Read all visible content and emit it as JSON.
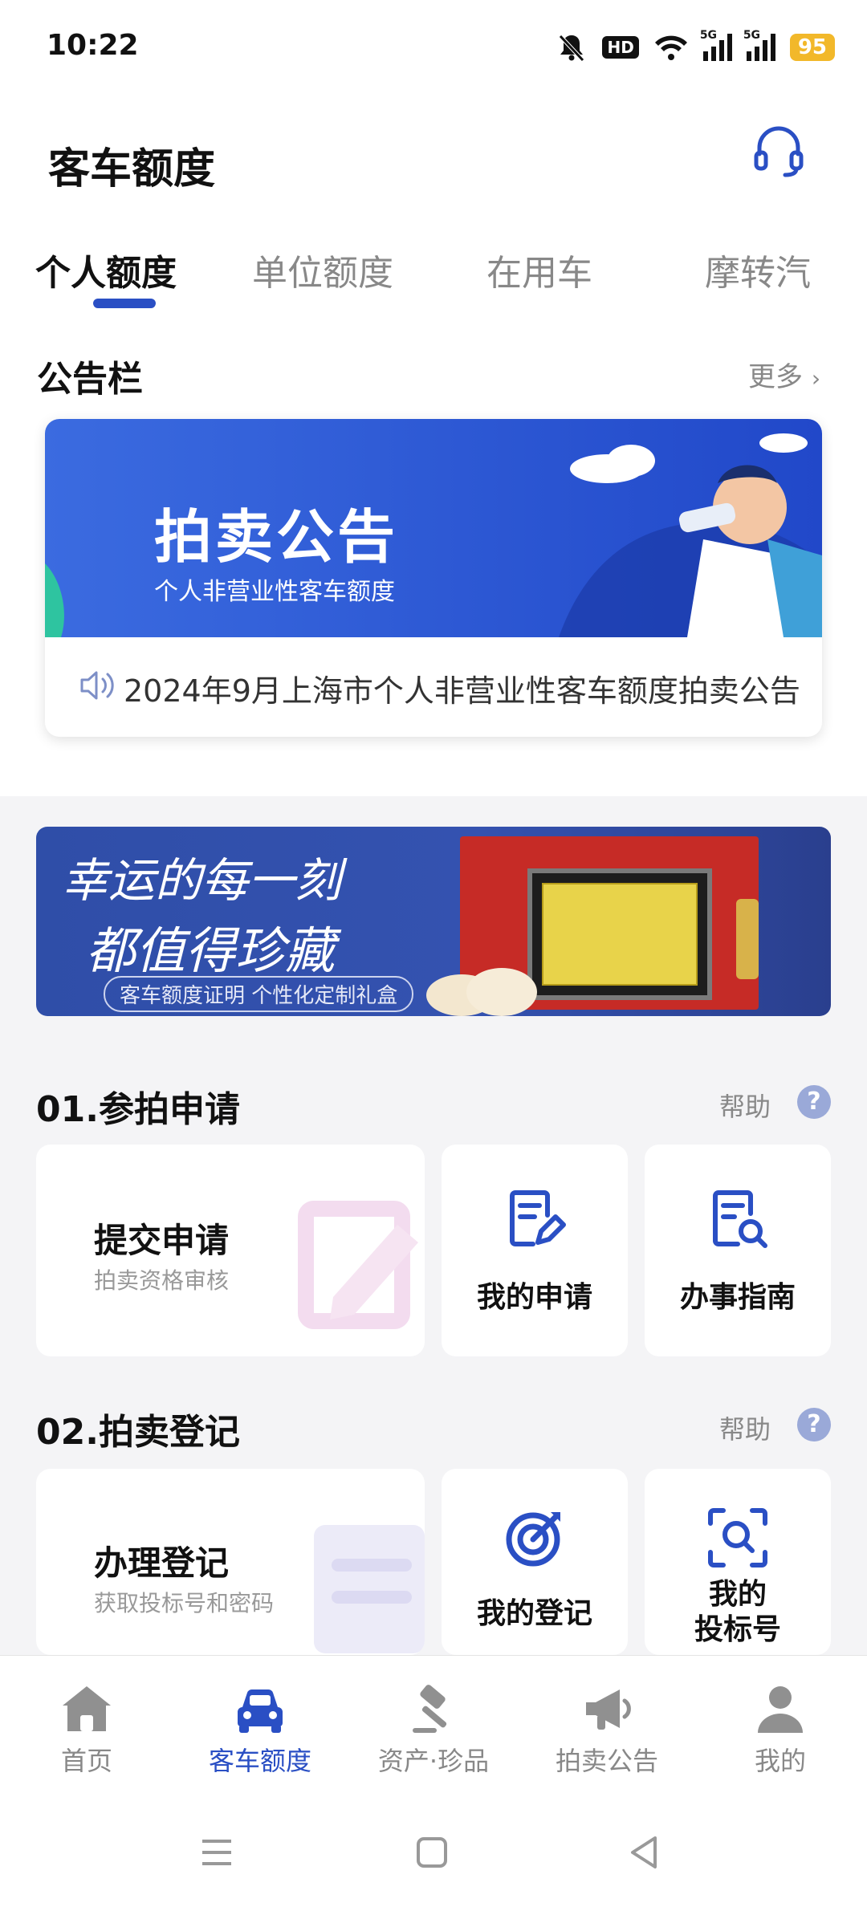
{
  "status_bar": {
    "time": "10:22",
    "battery": "95",
    "hd_label": "HD",
    "net1": "5G",
    "net2": "5G"
  },
  "header": {
    "title": "客车额度"
  },
  "tabs": [
    {
      "label": "个人额度",
      "active": true
    },
    {
      "label": "单位额度",
      "active": false
    },
    {
      "label": "在用车",
      "active": false
    },
    {
      "label": "摩转汽",
      "active": false
    }
  ],
  "notice": {
    "title": "公告栏",
    "more": "更多",
    "banner_title": "拍卖公告",
    "banner_subtitle": "个人非营业性客车额度",
    "announcement": "2024年9月上海市个人非营业性客车额度拍卖公告"
  },
  "promo_banner": {
    "line1": "幸运的每一刻",
    "line2": "都值得珍藏",
    "caption": "客车额度证明  个性化定制礼盒"
  },
  "section1": {
    "title": "01.参拍申请",
    "help": "帮助",
    "main_title": "提交申请",
    "main_subtitle": "拍卖资格审核",
    "item1": "我的申请",
    "item2": "办事指南"
  },
  "section2": {
    "title": "02.拍卖登记",
    "help": "帮助",
    "main_title": "办理登记",
    "main_subtitle": "获取投标号和密码",
    "item1": "我的登记",
    "item2_line1": "我的",
    "item2_line2": "投标号"
  },
  "bottom_nav": [
    {
      "label": "首页",
      "icon": "home-icon",
      "active": false
    },
    {
      "label": "客车额度",
      "icon": "car-icon",
      "active": true
    },
    {
      "label": "资产·珍品",
      "icon": "gavel-icon",
      "active": false
    },
    {
      "label": "拍卖公告",
      "icon": "megaphone-icon",
      "active": false
    },
    {
      "label": "我的",
      "icon": "user-icon",
      "active": false
    }
  ],
  "colors": {
    "accent": "#2a4fc4",
    "battery": "#f2b82a",
    "help_badge": "#9aa9d8"
  }
}
